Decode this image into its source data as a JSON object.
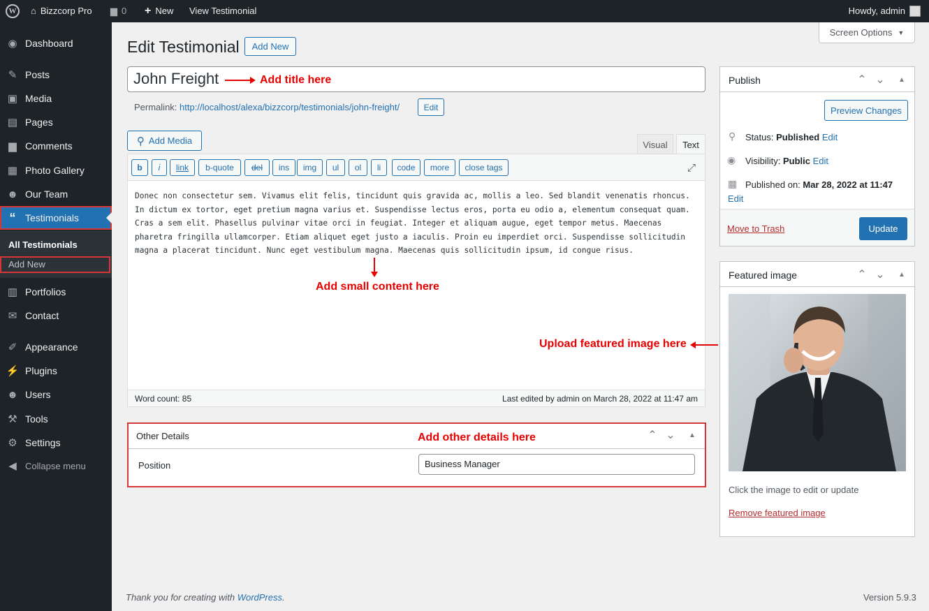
{
  "adminbar": {
    "site_name": "Bizzcorp Pro",
    "comments_count": "0",
    "new_label": "New",
    "view_label": "View Testimonial",
    "howdy": "Howdy, admin"
  },
  "sidebar": {
    "dashboard": "Dashboard",
    "posts": "Posts",
    "media": "Media",
    "pages": "Pages",
    "comments": "Comments",
    "photo_gallery": "Photo Gallery",
    "our_team": "Our Team",
    "testimonials": "Testimonials",
    "sub_all": "All Testimonials",
    "sub_add": "Add New",
    "portfolios": "Portfolios",
    "contact": "Contact",
    "appearance": "Appearance",
    "plugins": "Plugins",
    "users": "Users",
    "tools": "Tools",
    "settings": "Settings",
    "collapse": "Collapse menu"
  },
  "header": {
    "title": "Edit Testimonial",
    "add_new": "Add New",
    "screen_options": "Screen Options"
  },
  "post": {
    "title_value": "John Freight",
    "permalink_label": "Permalink:",
    "permalink_url_base": "http://localhost/alexa/bizzcorp/testimonials/",
    "permalink_slug": "john-freight",
    "permalink_trailing": "/",
    "permalink_edit": "Edit"
  },
  "editor": {
    "add_media": "Add Media",
    "tab_visual": "Visual",
    "tab_text": "Text",
    "quicktags": [
      "b",
      "i",
      "link",
      "b-quote",
      "del",
      "ins",
      "img",
      "ul",
      "ol",
      "li",
      "code",
      "more",
      "close tags"
    ],
    "content": "Donec non consectetur sem. Vivamus elit felis, tincidunt quis gravida ac, mollis a leo. Sed blandit venenatis rhoncus. In dictum ex tortor, eget pretium magna varius et. Suspendisse lectus eros, porta eu odio a, elementum consequat quam. Cras a sem elit. Phasellus pulvinar vitae orci in feugiat. Integer et aliquam augue, eget tempor metus. Maecenas pharetra fringilla ullamcorper. Etiam aliquet eget justo a iaculis. Proin eu imperdiet orci. Suspendisse sollicitudin magna a placerat tincidunt. Nunc eget vestibulum magna. Maecenas quis sollicitudin ipsum, id congue risus.",
    "word_count": "Word count: 85",
    "last_edited": "Last edited by admin on March 28, 2022 at 11:47 am"
  },
  "annotations": {
    "title": "Add title here",
    "content": "Add small content here",
    "featured": "Upload featured image here",
    "other": "Add other details here"
  },
  "other_details": {
    "heading": "Other Details",
    "position_label": "Position",
    "position_value": "Business Manager"
  },
  "publish": {
    "heading": "Publish",
    "preview": "Preview Changes",
    "status_label": "Status:",
    "status_value": "Published",
    "visibility_label": "Visibility:",
    "visibility_value": "Public",
    "published_label": "Published on:",
    "published_value": "Mar 28, 2022 at 11:47",
    "edit": "Edit",
    "trash": "Move to Trash",
    "update": "Update"
  },
  "featured": {
    "heading": "Featured image",
    "hint": "Click the image to edit or update",
    "remove": "Remove featured image"
  },
  "footer": {
    "thanks_prefix": "Thank you for creating with ",
    "wordpress": "WordPress",
    "thanks_suffix": ".",
    "version": "Version 5.9.3"
  },
  "colors": {
    "admin_dark": "#1d2327",
    "accent": "#2271b1",
    "annotation_red": "#e60000"
  }
}
